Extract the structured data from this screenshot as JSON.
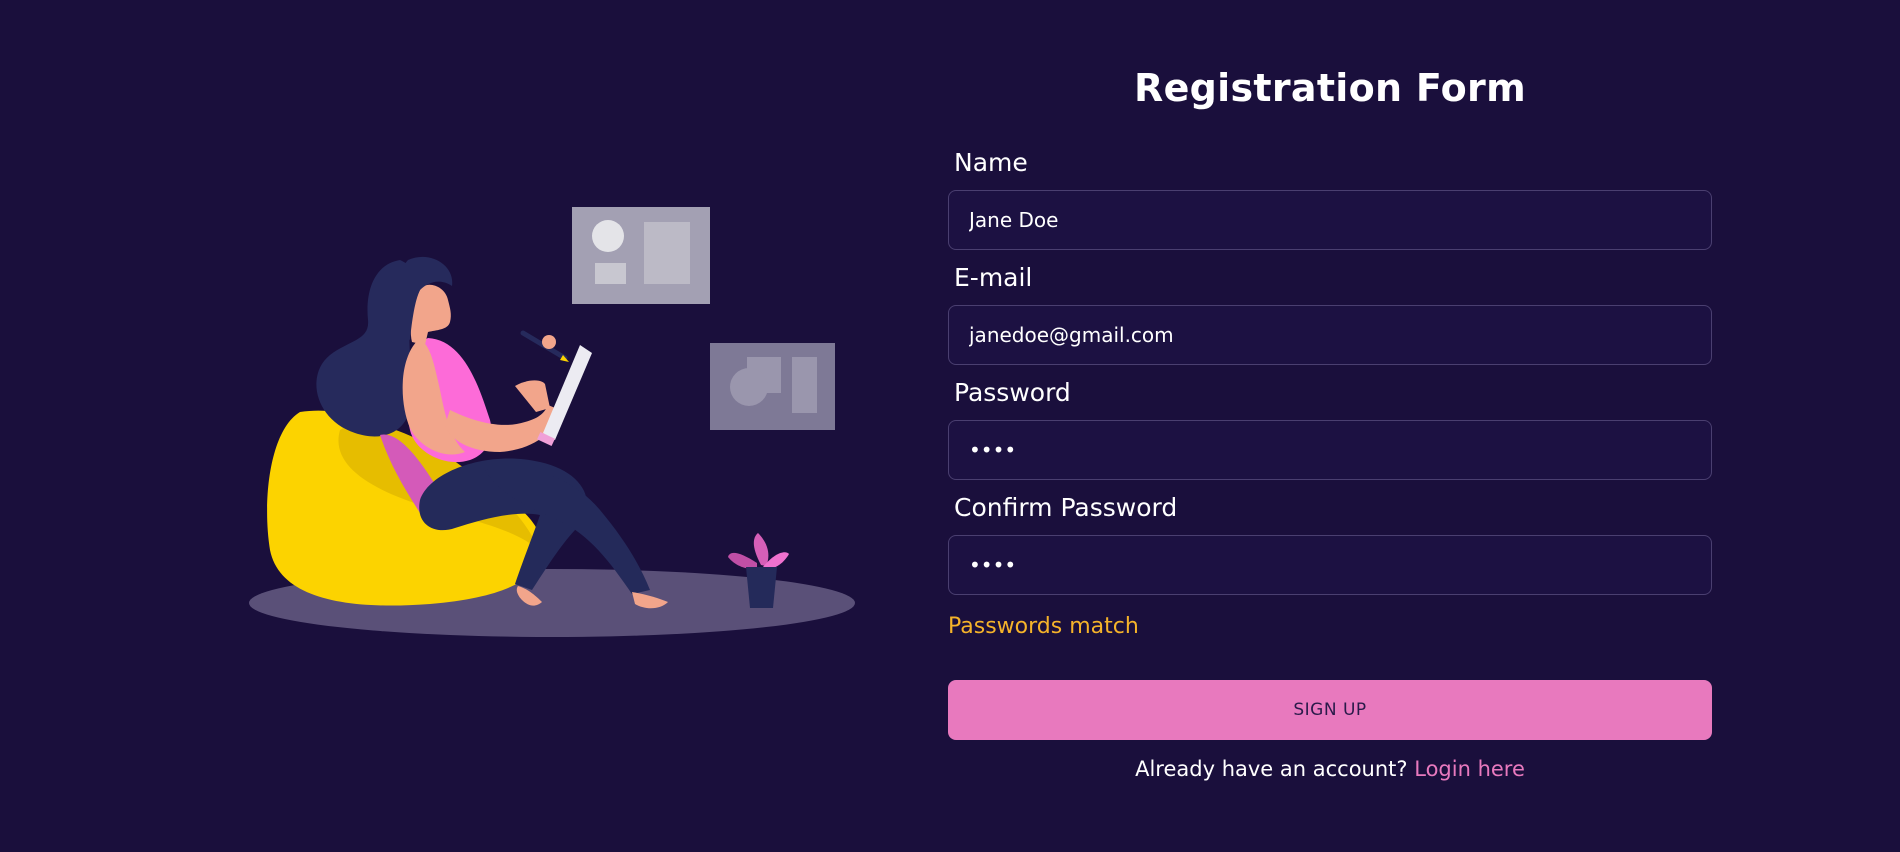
{
  "form": {
    "title": "Registration Form",
    "name_label": "Name",
    "name_value": "Jane Doe",
    "email_label": "E-mail",
    "email_value": "janedoe@gmail.com",
    "password_label": "Password",
    "password_value": "abcd",
    "confirm_label": "Confirm Password",
    "confirm_value": "abcd",
    "status_message": "Passwords match",
    "signup_label": "SIGN UP",
    "login_prompt": "Already have an account?",
    "login_link": "Login here"
  },
  "colors": {
    "background": "#1a0f3c",
    "accent": "#e879be",
    "status": "#f5b32a"
  },
  "illustration": {
    "subject": "woman-on-beanbag-writing-illustration"
  }
}
